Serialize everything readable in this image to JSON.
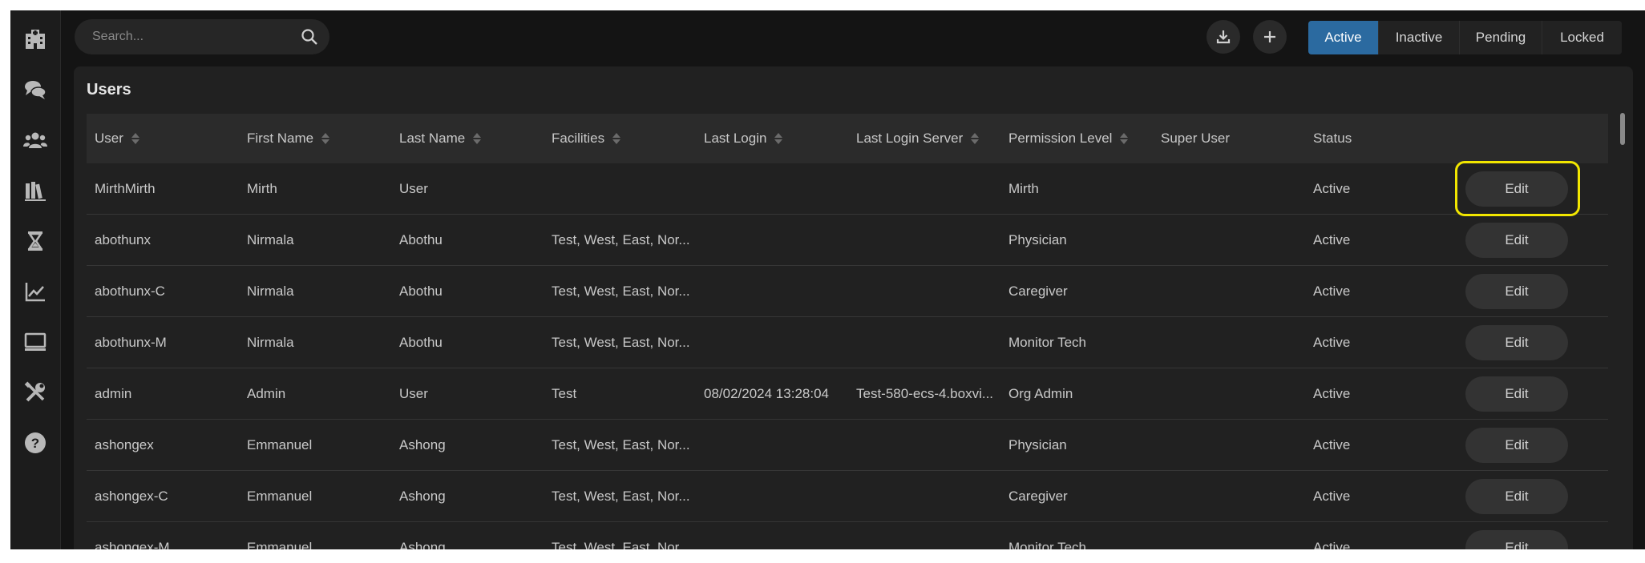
{
  "search": {
    "placeholder": "Search..."
  },
  "filter_tabs": [
    {
      "label": "Active",
      "active": true
    },
    {
      "label": "Inactive",
      "active": false
    },
    {
      "label": "Pending",
      "active": false
    },
    {
      "label": "Locked",
      "active": false
    }
  ],
  "panel": {
    "title": "Users"
  },
  "columns": [
    "User",
    "First Name",
    "Last Name",
    "Facilities",
    "Last Login",
    "Last Login Server",
    "Permission Level",
    "Super User",
    "Status"
  ],
  "rows": [
    {
      "user": "MirthMirth",
      "first": "Mirth",
      "last": "User",
      "facilities": "",
      "last_login": "",
      "server": "",
      "permission": "Mirth",
      "super": "",
      "status": "Active",
      "action": "Edit"
    },
    {
      "user": "abothunx",
      "first": "Nirmala",
      "last": "Abothu",
      "facilities": "Test, West, East, Nor...",
      "last_login": "",
      "server": "",
      "permission": "Physician",
      "super": "",
      "status": "Active",
      "action": "Edit"
    },
    {
      "user": "abothunx-C",
      "first": "Nirmala",
      "last": "Abothu",
      "facilities": "Test, West, East, Nor...",
      "last_login": "",
      "server": "",
      "permission": "Caregiver",
      "super": "",
      "status": "Active",
      "action": "Edit"
    },
    {
      "user": "abothunx-M",
      "first": "Nirmala",
      "last": "Abothu",
      "facilities": "Test, West, East, Nor...",
      "last_login": "",
      "server": "",
      "permission": "Monitor Tech",
      "super": "",
      "status": "Active",
      "action": "Edit"
    },
    {
      "user": "admin",
      "first": "Admin",
      "last": "User",
      "facilities": "Test",
      "last_login": "08/02/2024 13:28:04",
      "server": "Test-580-ecs-4.boxvi...",
      "permission": "Org Admin",
      "super": "",
      "status": "Active",
      "action": "Edit"
    },
    {
      "user": "ashongex",
      "first": "Emmanuel",
      "last": "Ashong",
      "facilities": "Test, West, East, Nor...",
      "last_login": "",
      "server": "",
      "permission": "Physician",
      "super": "",
      "status": "Active",
      "action": "Edit"
    },
    {
      "user": "ashongex-C",
      "first": "Emmanuel",
      "last": "Ashong",
      "facilities": "Test, West, East, Nor...",
      "last_login": "",
      "server": "",
      "permission": "Caregiver",
      "super": "",
      "status": "Active",
      "action": "Edit"
    },
    {
      "user": "ashongex-M",
      "first": "Emmanuel",
      "last": "Ashong",
      "facilities": "Test, West, East, Nor...",
      "last_login": "",
      "server": "",
      "permission": "Monitor Tech",
      "super": "",
      "status": "Active",
      "action": "Edit"
    }
  ],
  "colors": {
    "accent": "#2b6aa0",
    "highlight": "#f2e600",
    "icon": "#b8b8b8"
  },
  "sidebar_icons": [
    "hospital-icon",
    "chat-icon",
    "users-icon",
    "library-icon",
    "hourglass-icon",
    "chart-line-icon",
    "monitor-icon",
    "tools-icon",
    "help-icon"
  ]
}
